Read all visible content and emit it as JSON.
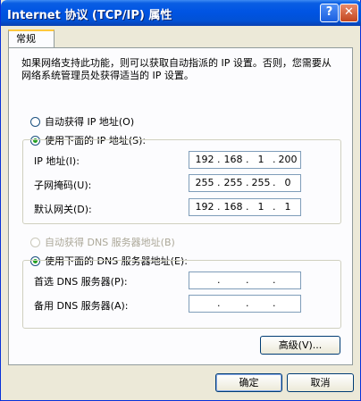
{
  "window": {
    "title": "Internet 协议 (TCP/IP) 属性",
    "help": "?",
    "close": "✕"
  },
  "tab": {
    "label": "常规"
  },
  "intro": "如果网络支持此功能，则可以获取自动指派的 IP 设置。否则，您需要从网络系统管理员处获得适当的 IP 设置。",
  "ip_section": {
    "auto_label": "自动获得 IP 地址(O)",
    "manual_label": "使用下面的 IP 地址(S):",
    "fields": [
      {
        "label": "IP 地址(I):",
        "segments": [
          "192",
          "168",
          "1",
          "200"
        ]
      },
      {
        "label": "子网掩码(U):",
        "segments": [
          "255",
          "255",
          "255",
          "0"
        ]
      },
      {
        "label": "默认网关(D):",
        "segments": [
          "192",
          "168",
          "1",
          "1"
        ]
      }
    ]
  },
  "dns_section": {
    "auto_label": "自动获得 DNS 服务器地址(B)",
    "manual_label": "使用下面的 DNS 服务器地址(E):",
    "fields": [
      {
        "label": "首选 DNS 服务器(P):",
        "segments": [
          "",
          "",
          "",
          ""
        ]
      },
      {
        "label": "备用 DNS 服务器(A):",
        "segments": [
          "",
          "",
          "",
          ""
        ]
      }
    ]
  },
  "buttons": {
    "advanced": "高级(V)...",
    "ok": "确定",
    "cancel": "取消"
  }
}
